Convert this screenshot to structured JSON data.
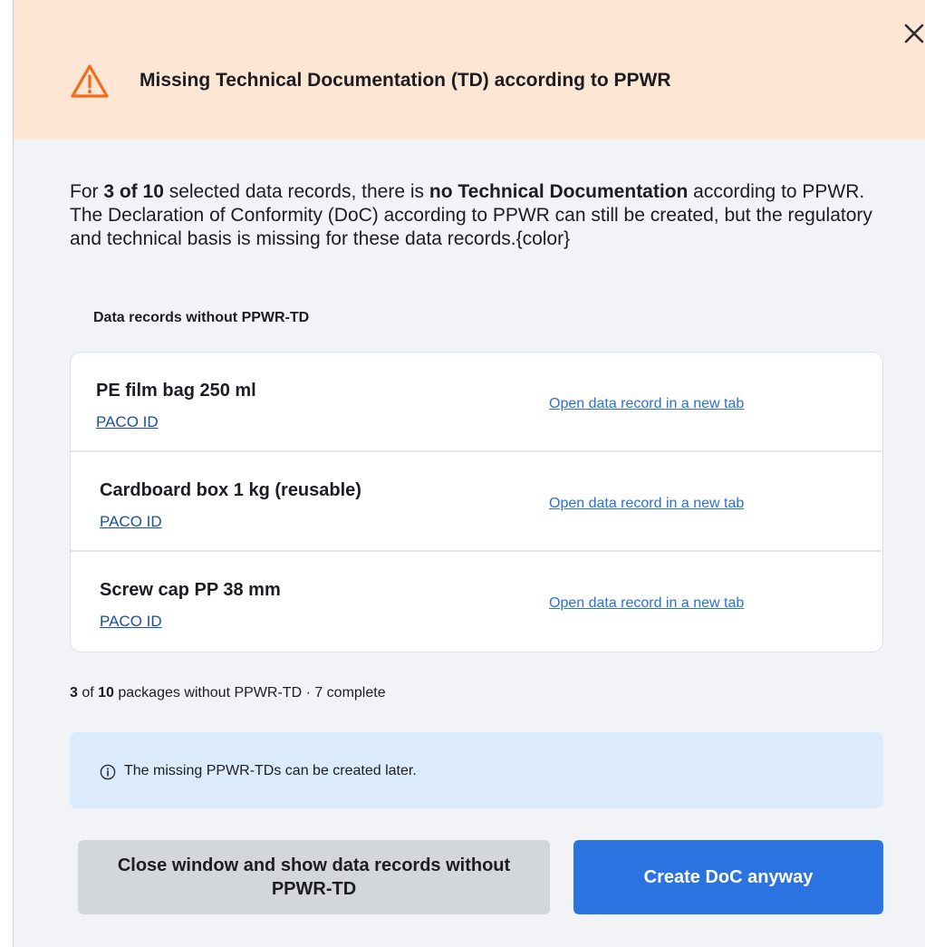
{
  "dialog": {
    "title": "Missing Technical Documentation (TD) according to PPWR",
    "close_icon": "close-icon",
    "warning_icon": "warning-triangle-icon",
    "warning_color": "#f26b1d",
    "header_bg": "#fde7d4"
  },
  "intro": {
    "part1": "For ",
    "count": "3 of 10",
    "part2": " selected data records, there is ",
    "emphasis": "no Technical Documentation",
    "part3": " according to PPWR. The Declaration of Conformity (DoC) according to PPWR can still be created, but the regulatory and technical basis is missing for these data records.{color}"
  },
  "records_section": {
    "label": "Data records without PPWR-TD",
    "items": [
      {
        "name": "PE film bag 250 ml",
        "id_label": "PACO ID",
        "open_link": "Open data record in a new tab"
      },
      {
        "name": "Cardboard box 1 kg (reusable)",
        "id_label": "PACO ID",
        "open_link": "Open data record in a new tab"
      },
      {
        "name": "Screw cap PP 38 mm",
        "id_label": "PACO ID",
        "open_link": "Open data record in a new tab"
      }
    ]
  },
  "summary": {
    "missing": "3",
    "of": " of ",
    "total": "10",
    "rest": " packages without PPWR-TD · 7 complete"
  },
  "info": {
    "icon": "info-circle-icon",
    "text": "The missing PPWR-TDs can be created later."
  },
  "actions": {
    "secondary_label": "Close window and show data records without PPWR-TD",
    "primary_label": "Create DoC anyway",
    "primary_color": "#2a73e0"
  }
}
